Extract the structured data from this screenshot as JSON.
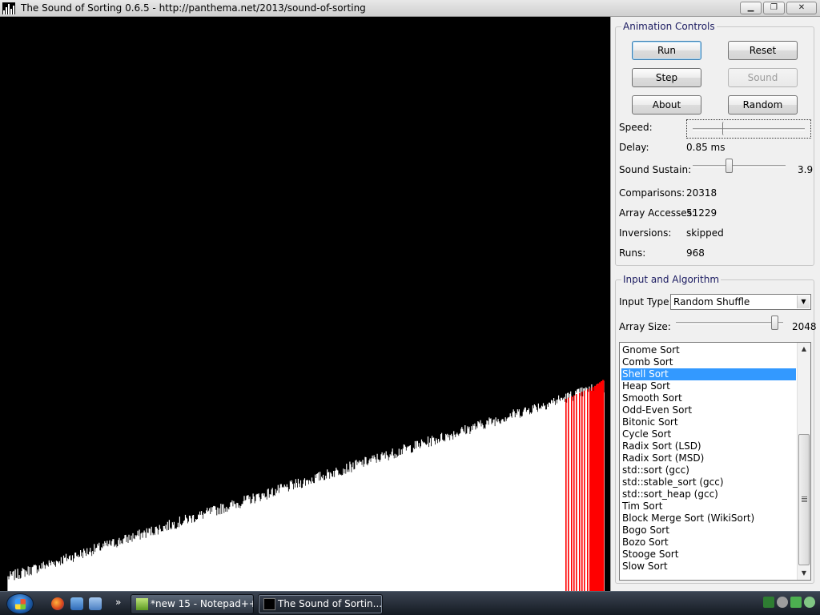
{
  "window": {
    "title": "The Sound of Sorting 0.6.5 - http://panthema.net/2013/sound-of-sorting",
    "minimize_glyph": "▁",
    "maximize_glyph": "❐",
    "close_glyph": "✕"
  },
  "animation_controls": {
    "group_title": "Animation Controls",
    "buttons": {
      "run": "Run",
      "reset": "Reset",
      "step": "Step",
      "sound": "Sound",
      "about": "About",
      "random": "Random"
    },
    "speed_label": "Speed:",
    "speed_level": 0.3,
    "delay_label": "Delay:",
    "delay_value": "0.85 ms",
    "sustain_label": "Sound Sustain:",
    "sustain_value": "3.9",
    "sustain_level": 0.38,
    "stats": [
      {
        "label": "Comparisons:",
        "value": "20318"
      },
      {
        "label": "Array Accesses:",
        "value": "51229"
      },
      {
        "label": "Inversions:",
        "value": "skipped"
      },
      {
        "label": "Runs:",
        "value": "968"
      }
    ]
  },
  "input_algorithm": {
    "group_title": "Input and Algorithm",
    "input_type_label": "Input Type:",
    "input_type_value": "Random Shuffle",
    "array_size_label": "Array Size:",
    "array_size_value": "2048",
    "array_size_level": 0.95,
    "algorithms": [
      "Gnome Sort",
      "Comb Sort",
      "Shell Sort",
      "Heap Sort",
      "Smooth Sort",
      "Odd-Even Sort",
      "Bitonic Sort",
      "Cycle Sort",
      "Radix Sort (LSD)",
      "Radix Sort (MSD)",
      "std::sort (gcc)",
      "std::stable_sort (gcc)",
      "std::sort_heap (gcc)",
      "Tim Sort",
      "Block Merge Sort (WikiSort)",
      "Bogo Sort",
      "Bozo Sort",
      "Stooge Sort",
      "Slow Sort"
    ],
    "selected_algorithm": "Shell Sort"
  },
  "visualization": {
    "bar_color": "#ffffff",
    "highlight_color": "#ff0000",
    "background": "#000000"
  },
  "taskbar": {
    "start_label": "Start",
    "overflow_glyph": "»",
    "tasks": [
      {
        "label": "*new 15 - Notepad++"
      },
      {
        "label": "The Sound of Sortin..."
      }
    ]
  }
}
